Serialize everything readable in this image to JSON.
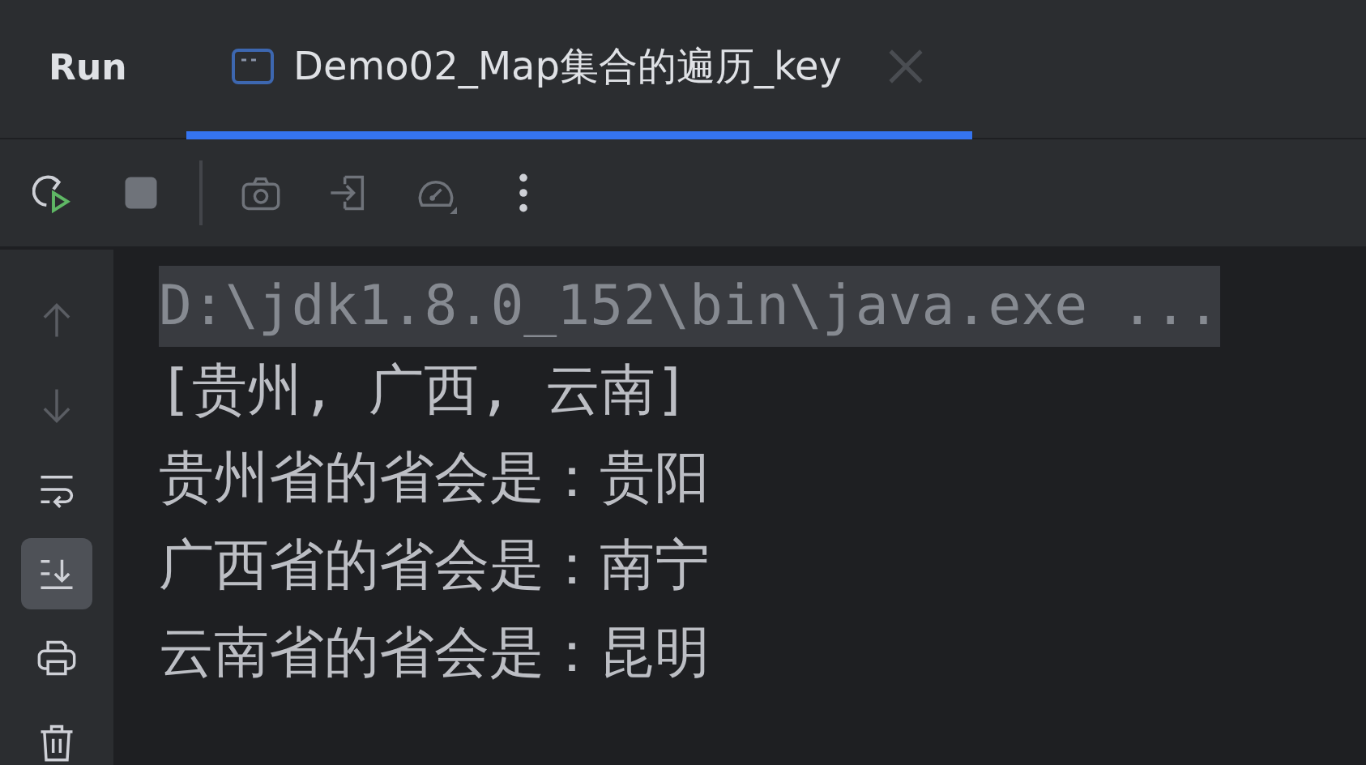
{
  "panel": {
    "title": "Run"
  },
  "tabs": [
    {
      "label": "Demo02_Map集合的遍历_key",
      "selected": true
    }
  ],
  "toolbar_groups": [
    [
      {
        "kind": "rerun",
        "disabled": false
      },
      {
        "kind": "stop",
        "disabled": true
      }
    ],
    [
      {
        "kind": "camera",
        "disabled": true
      },
      {
        "kind": "exit",
        "disabled": true
      },
      {
        "kind": "gauge",
        "disabled": true
      },
      {
        "kind": "more",
        "disabled": false
      }
    ]
  ],
  "side_tools": [
    {
      "kind": "up",
      "disabled": true,
      "selected": false
    },
    {
      "kind": "down",
      "disabled": true,
      "selected": false
    },
    {
      "kind": "wrap",
      "disabled": false,
      "selected": false
    },
    {
      "kind": "scroll-end",
      "disabled": false,
      "selected": true
    },
    {
      "kind": "print",
      "disabled": false,
      "selected": false
    },
    {
      "kind": "trash",
      "disabled": false,
      "selected": false
    }
  ],
  "console": [
    {
      "text": "D:\\jdk1.8.0_152\\bin\\java.exe ...",
      "kind": "command"
    },
    {
      "text": "[贵州, 广西, 云南]",
      "kind": "output"
    },
    {
      "text": "贵州省的省会是：贵阳",
      "kind": "output"
    },
    {
      "text": "广西省的省会是：南宁",
      "kind": "output"
    },
    {
      "text": "云南省的省会是：昆明",
      "kind": "output"
    }
  ]
}
